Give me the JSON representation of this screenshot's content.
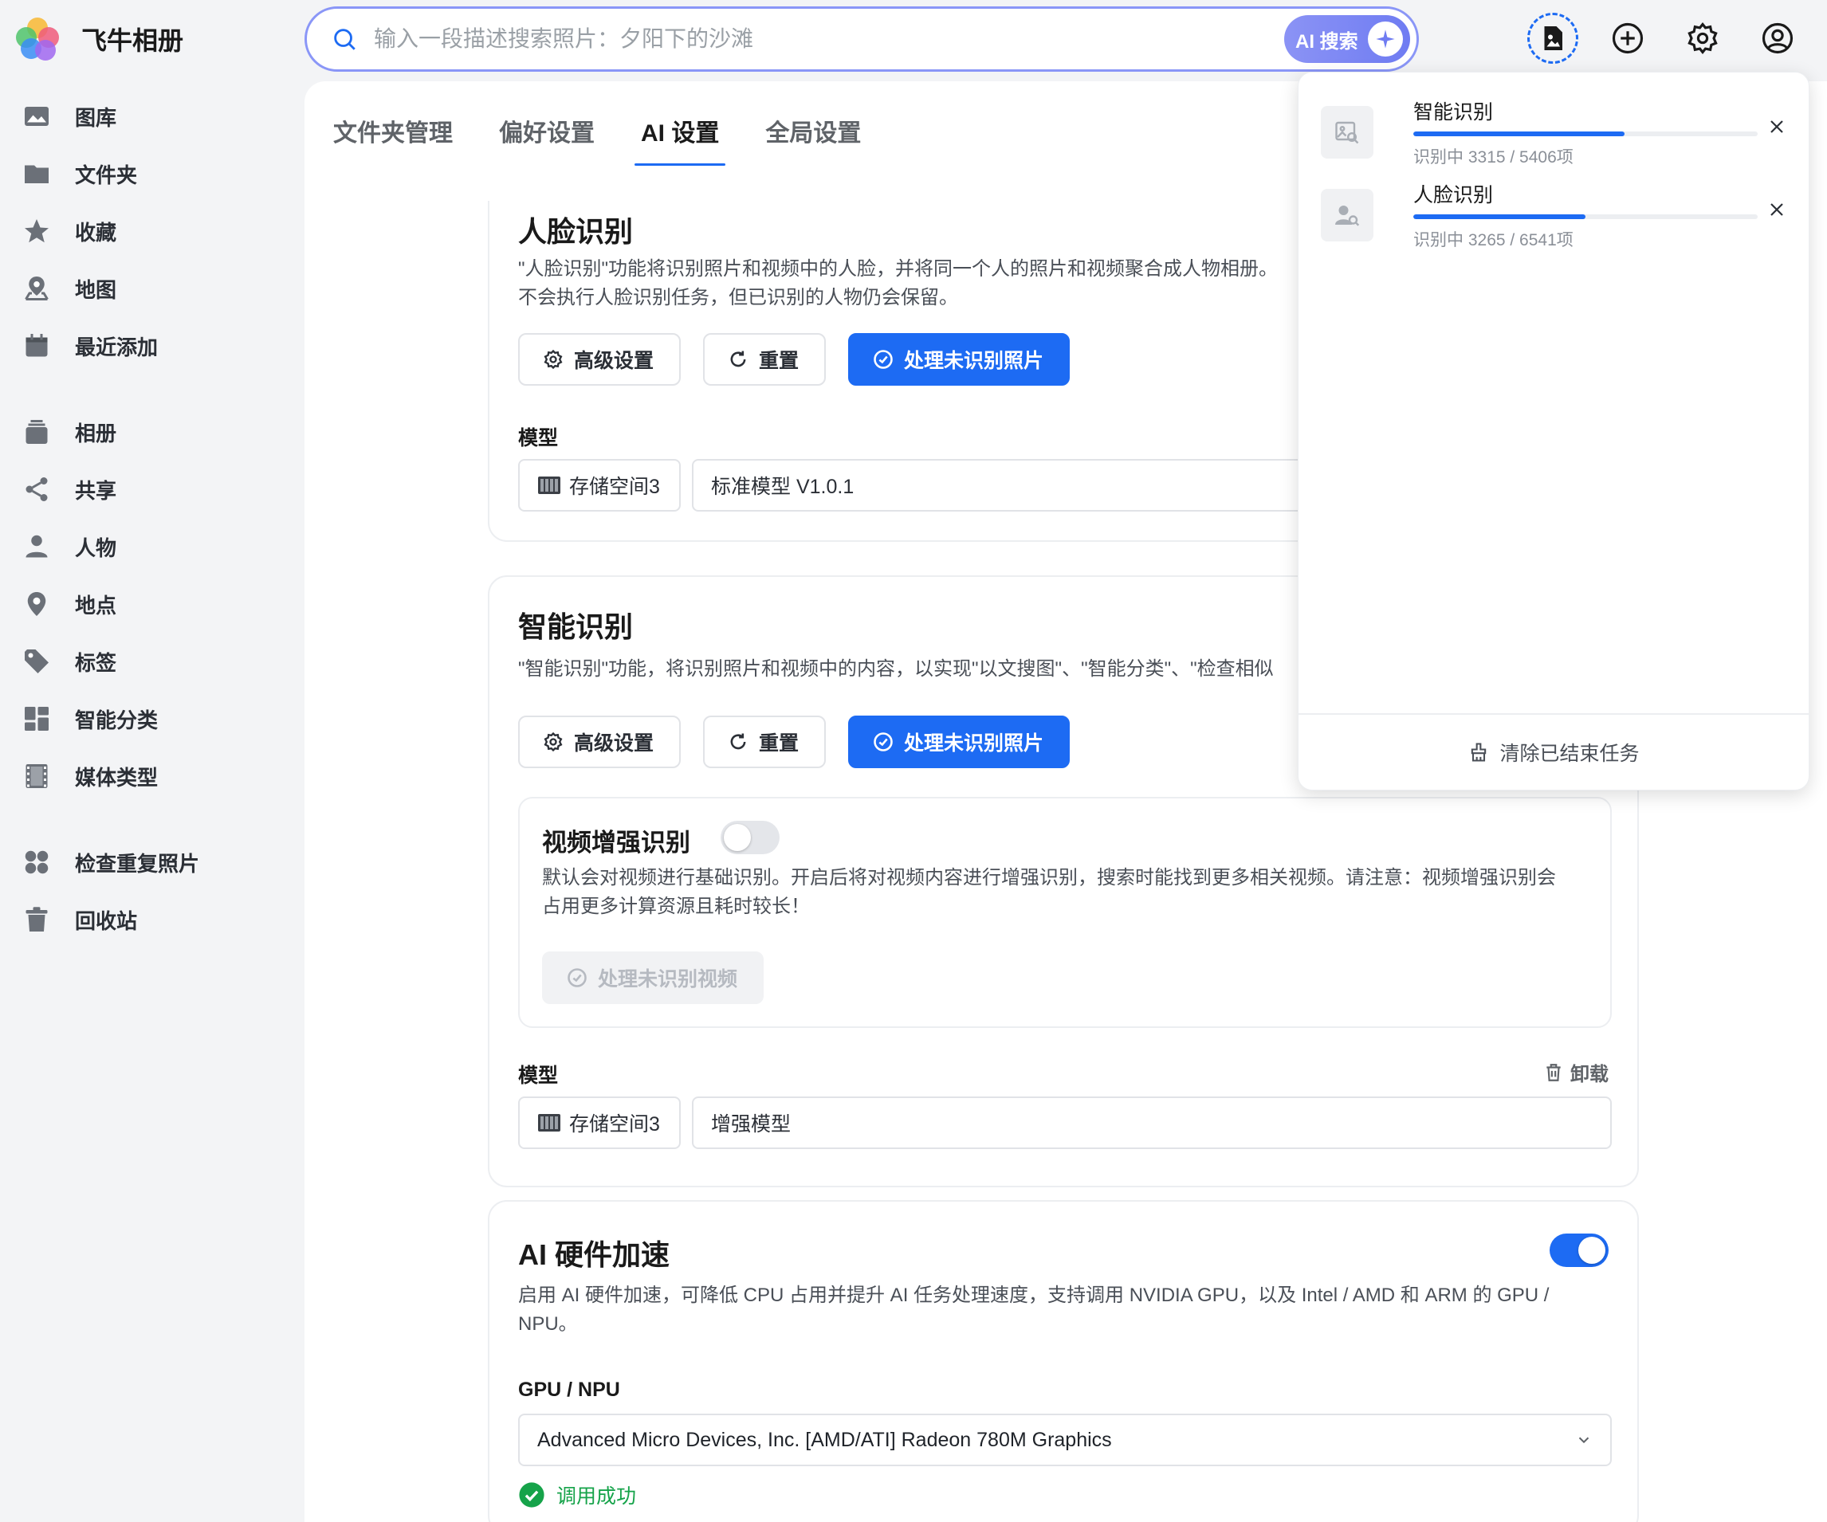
{
  "app": {
    "title": "飞牛相册"
  },
  "search": {
    "placeholder": "输入一段描述搜索照片：夕阳下的沙滩",
    "ai_button": "AI 搜索"
  },
  "topbar": {
    "icons": [
      "task-progress-icon",
      "add-circle-icon",
      "gear-icon",
      "user-circle-icon"
    ]
  },
  "sidebar": {
    "groups": [
      {
        "items": [
          {
            "label": "图库",
            "icon": "gallery-icon"
          },
          {
            "label": "文件夹",
            "icon": "folder-icon"
          },
          {
            "label": "收藏",
            "icon": "star-icon"
          },
          {
            "label": "地图",
            "icon": "map-pin-icon"
          },
          {
            "label": "最近添加",
            "icon": "calendar-icon"
          }
        ]
      },
      {
        "items": [
          {
            "label": "相册",
            "icon": "album-icon"
          },
          {
            "label": "共享",
            "icon": "share-icon"
          },
          {
            "label": "人物",
            "icon": "person-icon"
          },
          {
            "label": "地点",
            "icon": "location-icon"
          },
          {
            "label": "标签",
            "icon": "tag-icon"
          },
          {
            "label": "智能分类",
            "icon": "grid-icon"
          },
          {
            "label": "媒体类型",
            "icon": "film-icon"
          }
        ]
      },
      {
        "items": [
          {
            "label": "检查重复照片",
            "icon": "duplicate-icon"
          },
          {
            "label": "回收站",
            "icon": "trash-icon"
          }
        ]
      }
    ]
  },
  "tabs": [
    {
      "label": "文件夹管理"
    },
    {
      "label": "偏好设置"
    },
    {
      "label": "AI 设置",
      "active": true
    },
    {
      "label": "全局设置"
    }
  ],
  "face": {
    "title": "人脸识别",
    "desc1": "\"人脸识别\"功能将识别照片和视频中的人脸，并将同一个人的照片和视频聚合成人物相册。",
    "desc2": "不会执行人脸识别任务，但已识别的人物仍会保留。",
    "btn_advanced": "高级设置",
    "btn_reset": "重置",
    "btn_process": "处理未识别照片",
    "model_label": "模型",
    "storage": "存储空间3",
    "model": "标准模型 V1.0.1"
  },
  "smart": {
    "title": "智能识别",
    "desc": "\"智能识别\"功能，将识别照片和视频中的内容，以实现\"以文搜图\"、\"智能分类\"、\"检查相似",
    "btn_advanced": "高级设置",
    "btn_reset": "重置",
    "btn_process": "处理未识别照片",
    "video": {
      "title": "视频增强识别",
      "enabled": false,
      "desc": "默认会对视频进行基础识别。开启后将对视频内容进行增强识别，搜索时能找到更多相关视频。请注意：视频增强识别会占用更多计算资源且耗时较长！",
      "btn_process": "处理未识别视频"
    },
    "model_label": "模型",
    "uninstall": "卸载",
    "storage": "存储空间3",
    "model": "增强模型"
  },
  "hw": {
    "title": "AI 硬件加速",
    "enabled": true,
    "desc": "启用 AI 硬件加速，可降低 CPU 占用并提升 AI 任务处理速度，支持调用 NVIDIA GPU，以及 Intel / AMD 和 ARM 的 GPU / NPU。",
    "gpu_label": "GPU / NPU",
    "gpu_value": "Advanced Micro Devices, Inc. [AMD/ATI] Radeon 780M Graphics",
    "status": "调用成功"
  },
  "tasks": {
    "items": [
      {
        "name": "智能识别",
        "progress_text": "识别中 3315 / 5406项",
        "done": 3315,
        "total": 5406,
        "icon": "image-search-icon"
      },
      {
        "name": "人脸识别",
        "progress_text": "识别中 3265 / 6541项",
        "done": 3265,
        "total": 6541,
        "icon": "face-search-icon"
      }
    ],
    "clear_label": "清除已结束任务"
  },
  "colors": {
    "accent": "#1d6bf3",
    "success": "#16a34a",
    "ai_gradient_start": "#8b93f5"
  }
}
